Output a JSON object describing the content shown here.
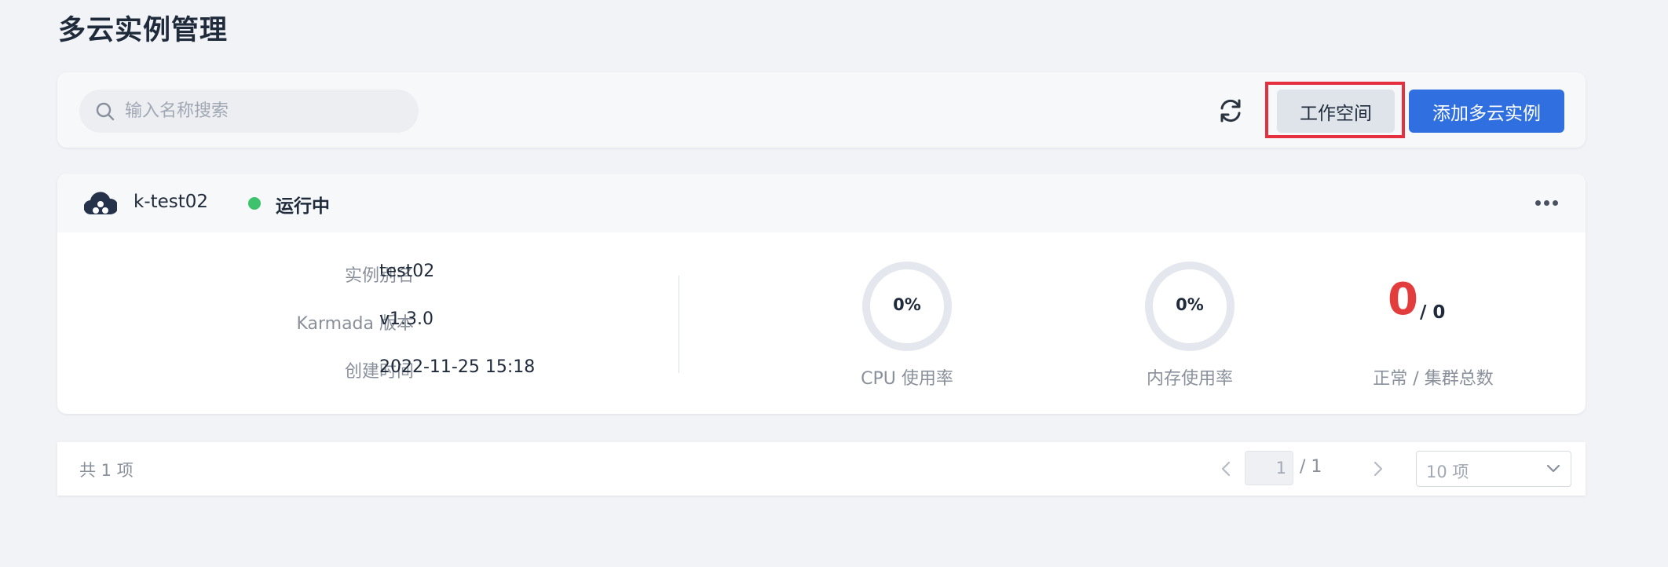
{
  "page": {
    "title": "多云实例管理"
  },
  "toolbar": {
    "search_placeholder": "输入名称搜索",
    "workspace_label": "工作空间",
    "add_label": "添加多云实例"
  },
  "card": {
    "name": "k-test02",
    "status": "运行中",
    "status_color": "#3ec26c",
    "info": [
      {
        "label": "实例别名",
        "value": "test02"
      },
      {
        "label": "Karmada 版本",
        "value": "v1.3.0"
      },
      {
        "label": "创建时间",
        "value": "2022-11-25 15:18"
      }
    ],
    "cpu": {
      "value": "0%",
      "label": "CPU 使用率"
    },
    "memory": {
      "value": "0%",
      "label": "内存使用率"
    },
    "clusters": {
      "normal": "0",
      "total": "/ 0",
      "label": "正常 / 集群总数"
    }
  },
  "pagination": {
    "total_text": "共 1 项",
    "current_page": "1",
    "page_total": "/ 1",
    "page_size": "10 项"
  },
  "colors": {
    "accent": "#2f6fe0",
    "highlight": "#e5303f",
    "danger": "#e23c3c"
  }
}
